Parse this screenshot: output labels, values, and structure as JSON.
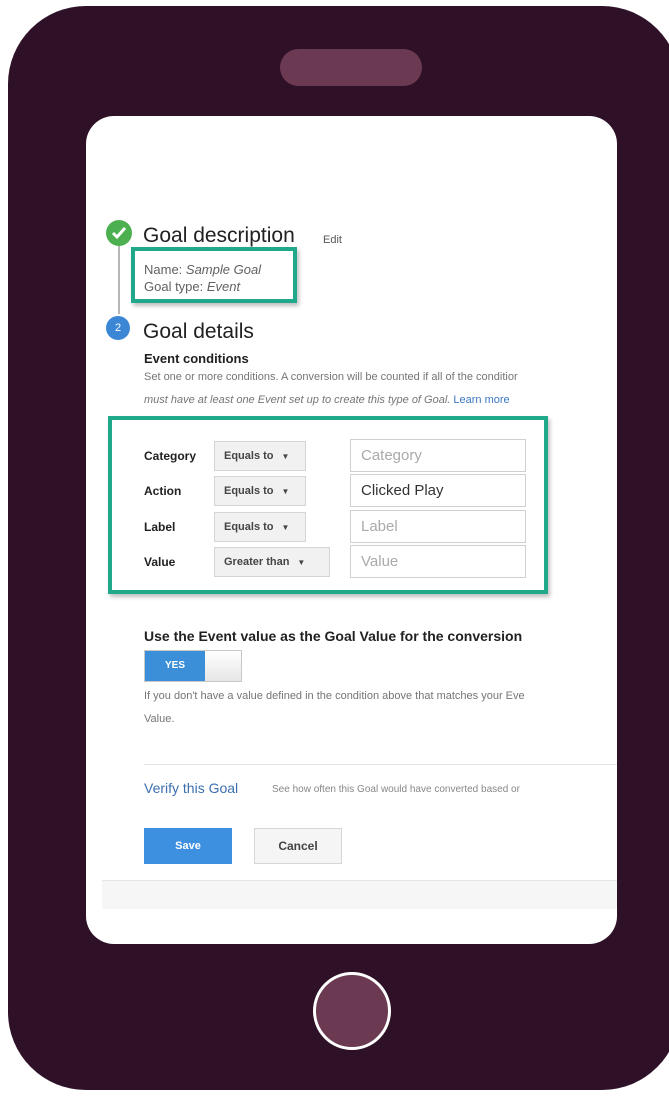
{
  "step1": {
    "title": "Goal description",
    "edit_label": "Edit",
    "name_label": "Name: ",
    "name_value": "Sample Goal",
    "type_label": "Goal type: ",
    "type_value": "Event",
    "icon": "check-icon",
    "color": "#4caf50"
  },
  "step2": {
    "number": "2",
    "title": "Goal details",
    "subtitle": "Event conditions",
    "help_line1": "Set one or more conditions. A conversion will be counted if all of the conditior",
    "help_line2": "must have at least one Event set up to create this type of Goal.",
    "learn_more": "Learn more",
    "color": "#3b87d6"
  },
  "conditions": [
    {
      "label": "Category",
      "operator": "Equals to",
      "placeholder": "Category",
      "value": ""
    },
    {
      "label": "Action",
      "operator": "Equals to",
      "placeholder": "",
      "value": "Clicked Play"
    },
    {
      "label": "Label",
      "operator": "Equals to",
      "placeholder": "Label",
      "value": ""
    },
    {
      "label": "Value",
      "operator": "Greater than",
      "placeholder": "Value",
      "value": ""
    }
  ],
  "goal_value": {
    "title": "Use the Event value as the Goal Value for the conversion",
    "toggle_label": "YES",
    "help_line1": "If you don't have a value defined in the condition above that matches your Eve",
    "help_line2": "Value."
  },
  "verify": {
    "link": "Verify this Goal",
    "help": "See how often this Goal would have converted based or"
  },
  "buttons": {
    "save": "Save",
    "cancel": "Cancel"
  },
  "colors": {
    "phone_body": "#2e1126",
    "phone_accent": "#6b3a52",
    "highlight": "#1fa88a",
    "primary": "#3d8fe0"
  }
}
